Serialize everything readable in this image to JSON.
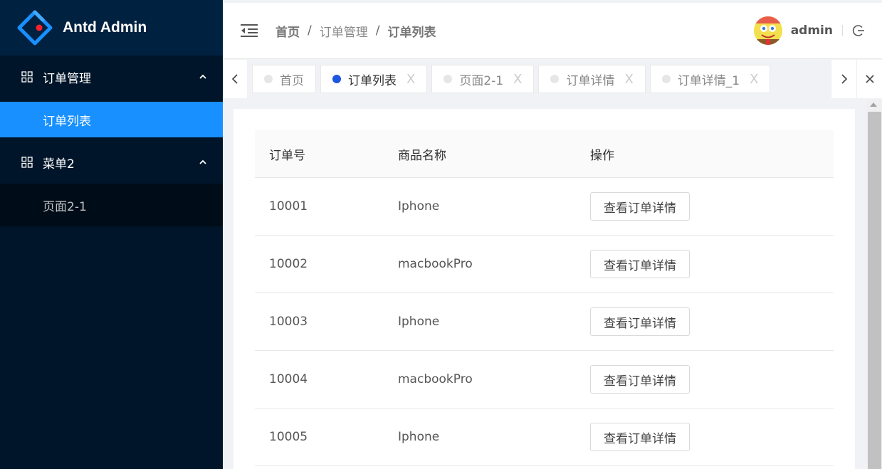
{
  "app": {
    "title": "Antd Admin"
  },
  "sidebar": {
    "menus": [
      {
        "label": "订单管理",
        "items": [
          {
            "label": "订单列表",
            "active": true
          }
        ]
      },
      {
        "label": "菜单2",
        "items": [
          {
            "label": "页面2-1",
            "active": false
          }
        ]
      }
    ]
  },
  "header": {
    "breadcrumb": [
      "首页",
      "订单管理",
      "订单列表"
    ],
    "separator": "/",
    "username": "admin"
  },
  "tabs": [
    {
      "label": "首页",
      "closable": false,
      "active": false
    },
    {
      "label": "订单列表",
      "closable": true,
      "active": true
    },
    {
      "label": "页面2-1",
      "closable": true,
      "active": false
    },
    {
      "label": "订单详情",
      "closable": true,
      "active": false
    },
    {
      "label": "订单详情_1",
      "closable": true,
      "active": false
    }
  ],
  "tab_close_glyph": "X",
  "table": {
    "columns": [
      "订单号",
      "商品名称",
      "操作"
    ],
    "action_label": "查看订单详情",
    "rows": [
      {
        "id": "10001",
        "name": "Iphone"
      },
      {
        "id": "10002",
        "name": "macbookPro"
      },
      {
        "id": "10003",
        "name": "Iphone"
      },
      {
        "id": "10004",
        "name": "macbookPro"
      },
      {
        "id": "10005",
        "name": "Iphone"
      }
    ]
  },
  "colors": {
    "sidebar_bg": "#001529",
    "active_menu": "#1890ff",
    "active_tab_dot": "#1d56e0",
    "logo_blue": "#1890ff",
    "logo_red": "#f5222d"
  }
}
